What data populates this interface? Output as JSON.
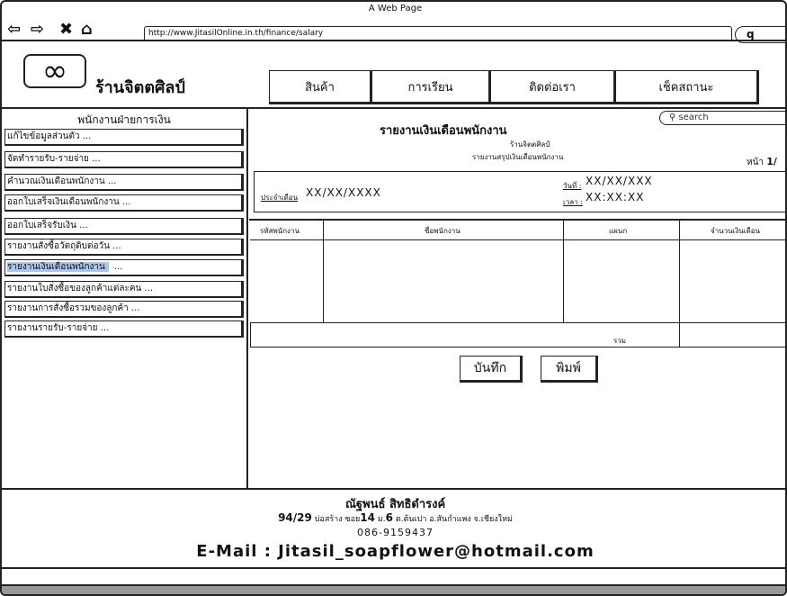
{
  "window": {
    "title": "A Web Page"
  },
  "browser": {
    "url": "http://www.JitasilOnline.in.th/finance/salary",
    "search_glyph": "q"
  },
  "header": {
    "logo_glyph": "∞",
    "shop_name": "ร้านจิตตศิลป์",
    "nav": [
      "สินค้า",
      "การเรียน",
      "ติดต่อเรา",
      "เช็คสถานะ"
    ]
  },
  "sidebar": {
    "title": "พนักงานฝ่ายการเงิน",
    "items": [
      "แก้ไขข้อมูลส่วนตัว  ...",
      "จัดทำรายรับ-รายจ่าย  ...",
      "คำนวณเงินเดือนพนักงาน  ...",
      "ออกใบเสร็จเงินเดือนพนักงาน  ...",
      "ออกใบเสร็จรับเงิน  ...",
      "รายงานสั่งซื้อวัตถุดิบต่อวัน  ...",
      "รายงานเงินเดือนพนักงาน",
      "รายงานใบสั่งซื้อของลูกค้าแต่ละคน  ...",
      "รายงานการสั่งซื้อรวมของลูกค้า  ...",
      "รายงานรายรับ-รายจ่าย  ..."
    ],
    "active_suffix": "...",
    "active_color": "#a9c6ee"
  },
  "report": {
    "search_placeholder": "search",
    "title": "รายงานเงินเดือนพนักงาน",
    "subtitle1": "ร้านจิตตศิลป์",
    "subtitle2": "รายงานสรุปเงินเดือนพนักงาน",
    "page_label": "หน้า",
    "page_value": "1/",
    "month_label": "ประจำเดือน",
    "month_value": "XX/XX/XXXX",
    "date_label": "วันที่ :",
    "date_value": "XX/XX/XXX",
    "time_label": "เวลา :",
    "time_value": "XX:XX:XX",
    "columns": [
      "รหัสพนักงาน",
      "ชื่อพนักงาน",
      "แผนก",
      "จำนวนเงินเดือน"
    ],
    "total_label": "รวม",
    "save_button": "บันทึก",
    "print_button": "พิมพ์"
  },
  "footer": {
    "name": "ณัฐพนธ์ สิทธิดำรงค์",
    "addr_number": "94/29",
    "addr_part1": "บ่อสร้าง ซอย",
    "addr_soi": "14",
    "addr_part2": "ม.",
    "addr_moo": "6",
    "addr_part3": "ต.ต้นเปา อ.สันกำแพง จ.เชียงใหม่",
    "phone": "086-9159437",
    "email": "E-Mail : Jitasil_soapflower@hotmail.com"
  }
}
